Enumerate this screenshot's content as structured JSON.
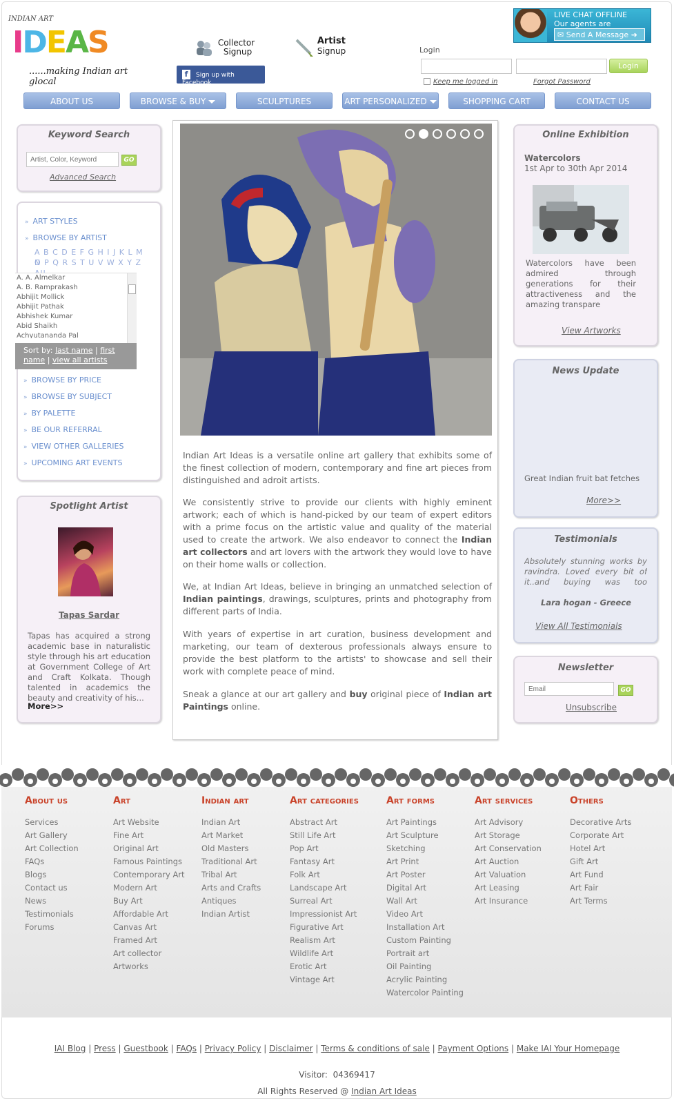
{
  "header": {
    "logo_top": "INDIAN ART",
    "logo_word": "IDEAS",
    "logo_tagline": "......making Indian art glocal",
    "collector_title": "Collector",
    "collector_sub": "Signup",
    "artist_title": "Artist",
    "artist_sub": "Signup",
    "facebook_label": "Sign up with Facebook",
    "chat_line1": "LIVE CHAT OFFLINE",
    "chat_line2": "Our agents are unavailable",
    "chat_button": "Send A Message",
    "login_label": "Login",
    "login_button": "Login",
    "keep_logged": "Keep me logged in",
    "forgot": "Forgot Password"
  },
  "nav": [
    "ABOUT US",
    "BROWSE & BUY",
    "SCULPTURES",
    "ART PERSONALIZED",
    "SHOPPING CART",
    "CONTACT US"
  ],
  "keyword_search": {
    "title": "Keyword Search",
    "placeholder": "Artist, Color, Keyword",
    "go": "GO",
    "advanced": "Advanced Search"
  },
  "left_menu": {
    "art_styles": "ART STYLES",
    "browse_by_artist": "BROWSE BY ARTIST",
    "alpha1": "A B C D E F G H I J K L M N",
    "alpha2": "O P Q R S T U V W X Y Z All",
    "artists": [
      "A. A. Almelkar",
      "A. B. Ramprakash",
      "Abhijit Mollick",
      "Abhijit Pathak",
      "Abhishek Kumar",
      "Abid Shaikh",
      "Achyutananda Pal"
    ],
    "sort_by": "Sort by:",
    "sort_last": "last name",
    "sort_sep": "|",
    "sort_first": "first name",
    "sort_all": "view all artists",
    "items": [
      "BROWSE BY PRICE",
      "BROWSE BY SUBJECT",
      "BY PALETTE",
      "BE OUR REFERRAL",
      "VIEW OTHER GALLERIES",
      "UPCOMING ART EVENTS"
    ]
  },
  "spotlight": {
    "title": "Spotlight Artist",
    "name": "Tapas Sardar",
    "text": "Tapas has acquired a strong academic base in naturalistic style through his art education at Government College of Art and Craft Kolkata. Though talented in academics the beauty and creativity of his...",
    "more": "More>>"
  },
  "center": {
    "p1a": "Indian Art Ideas is a versatile online art gallery that exhibits some of the finest collection of modern, contemporary and fine art pieces from distinguished and adroit artists.",
    "p2a": "We consistently strive to provide our clients with highly eminent artwork; each of which is hand-picked by our team of expert editors with a prime focus on the artistic value and quality of the material used to create the artwork. We also endeavor to connect the ",
    "p2b": "Indian art collectors",
    "p2c": " and art lovers with the artwork they would love to have on their home walls or collection.",
    "p3a": "We, at Indian Art Ideas, believe in bringing an unmatched selection of ",
    "p3b": "Indian paintings",
    "p3c": ", drawings, sculptures, prints and photography from different parts of India.",
    "p4a": "With years of expertise in art curation, business development and marketing, our team of dexterous professionals always ensure to provide the best platform to the artists' to showcase and sell their work with complete peace of mind.",
    "p5a": "Sneak a glance at our art gallery and ",
    "p5b": "buy",
    "p5c": " original piece of ",
    "p5d": "Indian art Paintings",
    "p5e": " online."
  },
  "exhibition": {
    "title": "Online Exhibition",
    "name": "Watercolors",
    "dates": "1st Apr to 30th Apr 2014",
    "text": "Watercolors have been admired through generations for their attractiveness and the amazing transpare",
    "link": "View Artworks"
  },
  "news": {
    "title": "News Update",
    "headline": "Great Indian fruit bat fetches",
    "more": "More>>"
  },
  "testimonials": {
    "title": "Testimonials",
    "quote": "Absolutely stunning works by ravindra. Loved every bit of it..and buying was too convenient",
    "author": "Lara hogan - Greece",
    "link": "View All Testimonials"
  },
  "newsletter": {
    "title": "Newsletter",
    "placeholder": "Email",
    "go": "GO",
    "unsubscribe": "Unsubscribe"
  },
  "footer_columns": [
    {
      "title": "About us",
      "items": [
        "Services",
        "Art Gallery",
        "Art Collection",
        "FAQs",
        "Blogs",
        "Contact us",
        "News",
        "Testimonials",
        "Forums"
      ]
    },
    {
      "title": "Art",
      "items": [
        "Art Website",
        "Fine Art",
        "Original Art",
        "Famous Paintings",
        "Contemporary Art",
        "Modern Art",
        "Buy Art",
        "Affordable Art",
        "Canvas Art",
        "Framed Art",
        "Art collector",
        "Artworks"
      ]
    },
    {
      "title": "Indian art",
      "items": [
        "Indian Art",
        "Art Market",
        "Old Masters",
        "Traditional Art",
        "Tribal Art",
        "Arts and Crafts",
        "Antiques",
        "Indian Artist"
      ]
    },
    {
      "title": "Art categories",
      "items": [
        "Abstract Art",
        "Still Life Art",
        "Pop Art",
        "Fantasy Art",
        "Folk Art",
        "Landscape Art",
        "Surreal Art",
        "Impressionist Art",
        "Figurative Art",
        "Realism Art",
        "Wildlife Art",
        "Erotic Art",
        "Vintage Art"
      ]
    },
    {
      "title": "Art forms",
      "items": [
        "Art Paintings",
        "Art Sculpture",
        "Sketching",
        "Art Print",
        "Art Poster",
        "Digital Art",
        "Wall Art",
        "Video Art",
        "Installation Art",
        "Custom Painting",
        "Portrait art",
        "Oil Painting",
        "Acrylic Painting",
        "Watercolor Painting"
      ]
    },
    {
      "title": "Art services",
      "items": [
        "Art Advisory",
        "Art Storage",
        "Art Conservation",
        "Art Auction",
        "Art Valuation",
        "Art Leasing",
        "Art Insurance"
      ]
    },
    {
      "title": "Others",
      "items": [
        "Decorative Arts",
        "Corporate Art",
        "Hotel Art",
        "Gift Art",
        "Art Fund",
        "Art Fair",
        "Art Terms"
      ]
    }
  ],
  "bottom_links": [
    "IAI Blog",
    "Press",
    "Guestbook",
    "FAQs",
    "Privacy Policy",
    "Disclaimer",
    "Terms & conditions of sale",
    "Payment Options",
    "Make IAI Your Homepage"
  ],
  "visitor_label": "Visitor:",
  "visitor_count": "04369417",
  "rights": "All Rights Reserved @",
  "rights_link": "Indian Art Ideas"
}
